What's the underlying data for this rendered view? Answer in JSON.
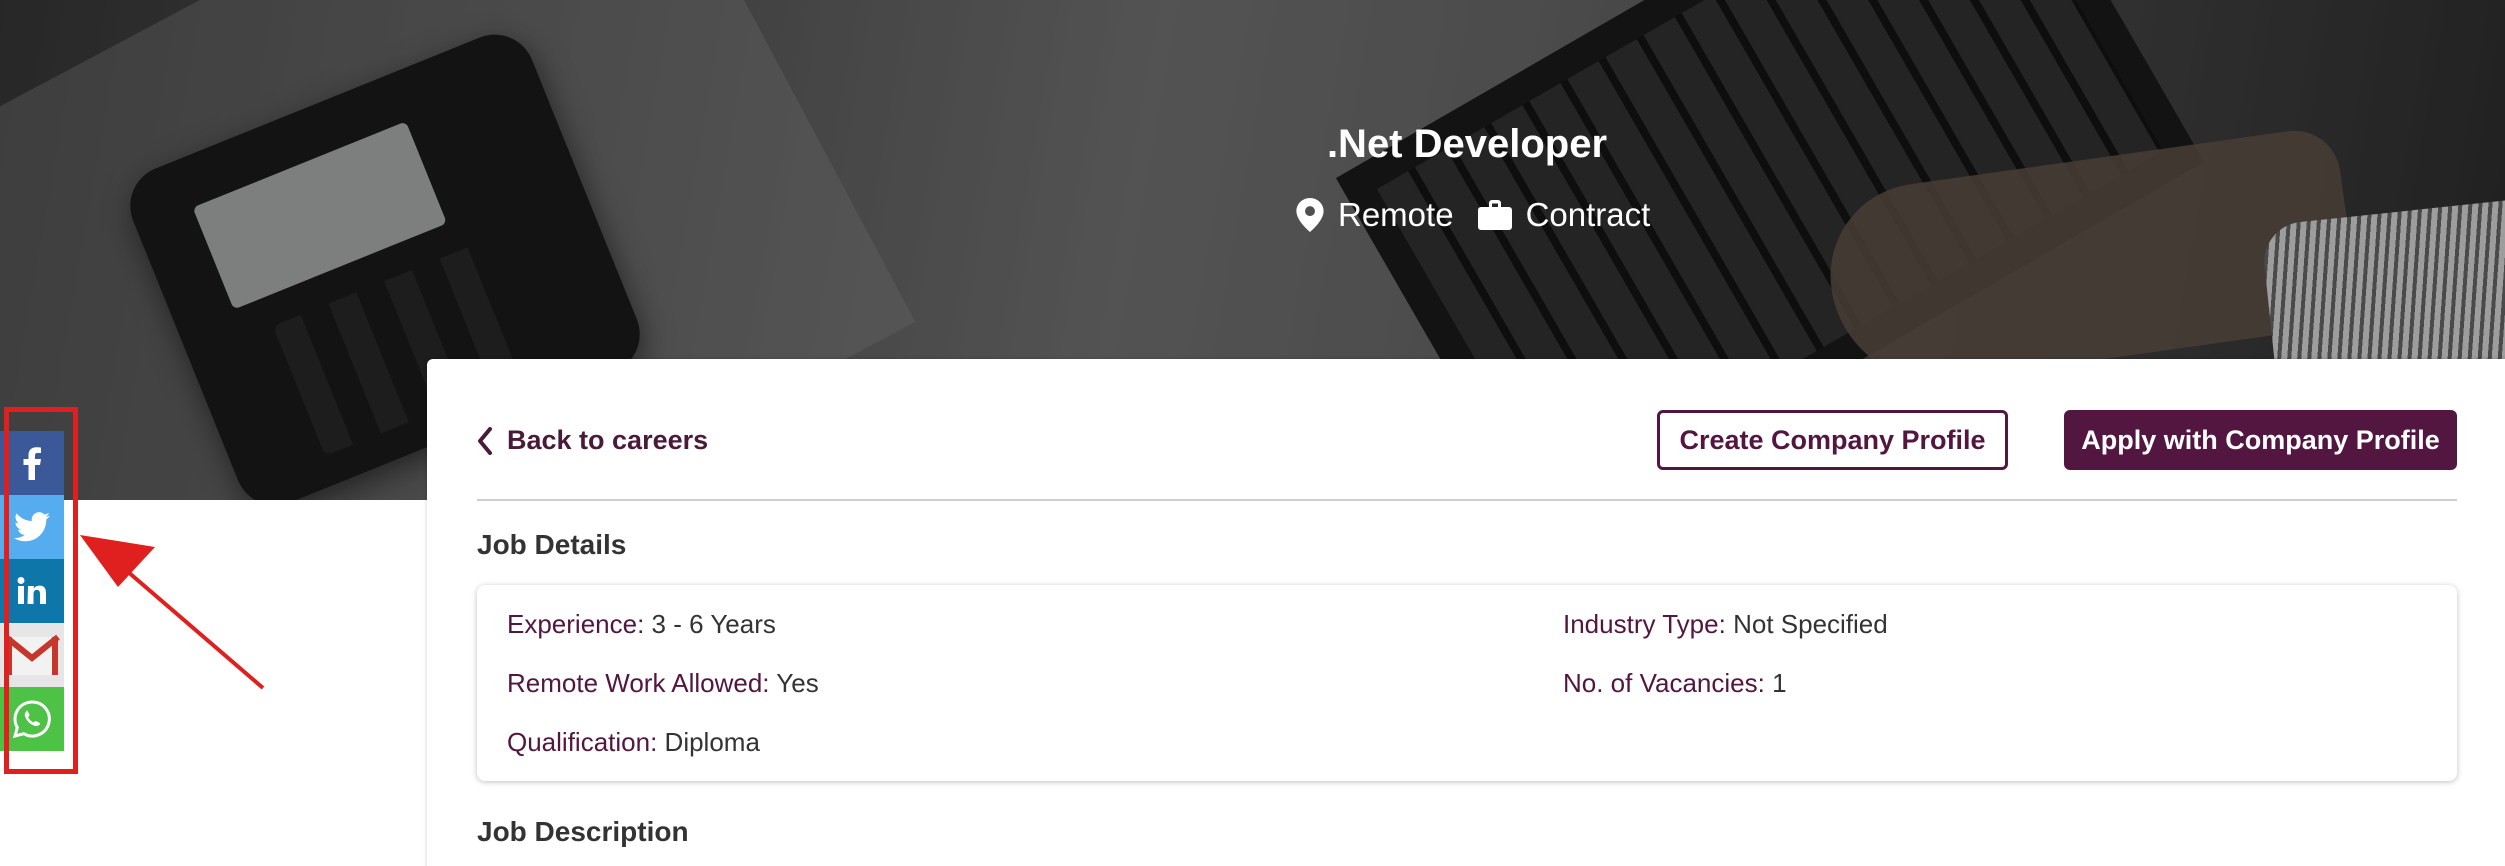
{
  "hero": {
    "title": ".Net Developer",
    "location": "Remote",
    "job_type": "Contract"
  },
  "share": {
    "icons": [
      "facebook-icon",
      "twitter-icon",
      "linkedin-icon",
      "gmail-icon",
      "whatsapp-icon"
    ]
  },
  "toolbar": {
    "back_label": "Back to careers",
    "create_profile_label": "Create Company Profile",
    "apply_label": "Apply with Company Profile"
  },
  "job_details": {
    "title": "Job Details",
    "experience_label": "Experience:",
    "experience_value": "3 - 6 Years",
    "remote_label": "Remote Work Allowed:",
    "remote_value": "Yes",
    "qualification_label": "Qualification:",
    "qualification_value": "Diploma",
    "industry_label": "Industry Type:",
    "industry_value": "Not Specified",
    "vacancies_label": "No. of Vacancies:",
    "vacancies_value": "1"
  },
  "job_description": {
    "title": "Job Description"
  },
  "colors": {
    "brand": "#521640",
    "facebook": "#3b5998",
    "twitter": "#55acee",
    "linkedin": "#0e76a8",
    "whatsapp": "#4dc247",
    "annotation": "#e0201e"
  }
}
